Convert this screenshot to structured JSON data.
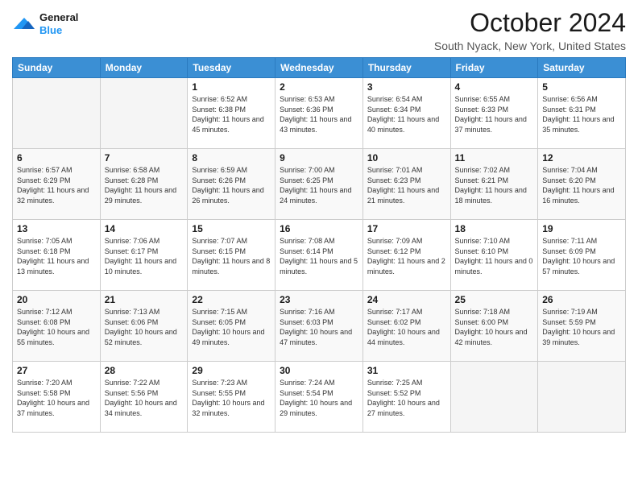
{
  "header": {
    "logo_line1": "General",
    "logo_line2": "Blue",
    "month_title": "October 2024",
    "location": "South Nyack, New York, United States"
  },
  "weekdays": [
    "Sunday",
    "Monday",
    "Tuesday",
    "Wednesday",
    "Thursday",
    "Friday",
    "Saturday"
  ],
  "weeks": [
    [
      {
        "day": null
      },
      {
        "day": null
      },
      {
        "day": "1",
        "sunrise": "Sunrise: 6:52 AM",
        "sunset": "Sunset: 6:38 PM",
        "daylight": "Daylight: 11 hours and 45 minutes."
      },
      {
        "day": "2",
        "sunrise": "Sunrise: 6:53 AM",
        "sunset": "Sunset: 6:36 PM",
        "daylight": "Daylight: 11 hours and 43 minutes."
      },
      {
        "day": "3",
        "sunrise": "Sunrise: 6:54 AM",
        "sunset": "Sunset: 6:34 PM",
        "daylight": "Daylight: 11 hours and 40 minutes."
      },
      {
        "day": "4",
        "sunrise": "Sunrise: 6:55 AM",
        "sunset": "Sunset: 6:33 PM",
        "daylight": "Daylight: 11 hours and 37 minutes."
      },
      {
        "day": "5",
        "sunrise": "Sunrise: 6:56 AM",
        "sunset": "Sunset: 6:31 PM",
        "daylight": "Daylight: 11 hours and 35 minutes."
      }
    ],
    [
      {
        "day": "6",
        "sunrise": "Sunrise: 6:57 AM",
        "sunset": "Sunset: 6:29 PM",
        "daylight": "Daylight: 11 hours and 32 minutes."
      },
      {
        "day": "7",
        "sunrise": "Sunrise: 6:58 AM",
        "sunset": "Sunset: 6:28 PM",
        "daylight": "Daylight: 11 hours and 29 minutes."
      },
      {
        "day": "8",
        "sunrise": "Sunrise: 6:59 AM",
        "sunset": "Sunset: 6:26 PM",
        "daylight": "Daylight: 11 hours and 26 minutes."
      },
      {
        "day": "9",
        "sunrise": "Sunrise: 7:00 AM",
        "sunset": "Sunset: 6:25 PM",
        "daylight": "Daylight: 11 hours and 24 minutes."
      },
      {
        "day": "10",
        "sunrise": "Sunrise: 7:01 AM",
        "sunset": "Sunset: 6:23 PM",
        "daylight": "Daylight: 11 hours and 21 minutes."
      },
      {
        "day": "11",
        "sunrise": "Sunrise: 7:02 AM",
        "sunset": "Sunset: 6:21 PM",
        "daylight": "Daylight: 11 hours and 18 minutes."
      },
      {
        "day": "12",
        "sunrise": "Sunrise: 7:04 AM",
        "sunset": "Sunset: 6:20 PM",
        "daylight": "Daylight: 11 hours and 16 minutes."
      }
    ],
    [
      {
        "day": "13",
        "sunrise": "Sunrise: 7:05 AM",
        "sunset": "Sunset: 6:18 PM",
        "daylight": "Daylight: 11 hours and 13 minutes."
      },
      {
        "day": "14",
        "sunrise": "Sunrise: 7:06 AM",
        "sunset": "Sunset: 6:17 PM",
        "daylight": "Daylight: 11 hours and 10 minutes."
      },
      {
        "day": "15",
        "sunrise": "Sunrise: 7:07 AM",
        "sunset": "Sunset: 6:15 PM",
        "daylight": "Daylight: 11 hours and 8 minutes."
      },
      {
        "day": "16",
        "sunrise": "Sunrise: 7:08 AM",
        "sunset": "Sunset: 6:14 PM",
        "daylight": "Daylight: 11 hours and 5 minutes."
      },
      {
        "day": "17",
        "sunrise": "Sunrise: 7:09 AM",
        "sunset": "Sunset: 6:12 PM",
        "daylight": "Daylight: 11 hours and 2 minutes."
      },
      {
        "day": "18",
        "sunrise": "Sunrise: 7:10 AM",
        "sunset": "Sunset: 6:10 PM",
        "daylight": "Daylight: 11 hours and 0 minutes."
      },
      {
        "day": "19",
        "sunrise": "Sunrise: 7:11 AM",
        "sunset": "Sunset: 6:09 PM",
        "daylight": "Daylight: 10 hours and 57 minutes."
      }
    ],
    [
      {
        "day": "20",
        "sunrise": "Sunrise: 7:12 AM",
        "sunset": "Sunset: 6:08 PM",
        "daylight": "Daylight: 10 hours and 55 minutes."
      },
      {
        "day": "21",
        "sunrise": "Sunrise: 7:13 AM",
        "sunset": "Sunset: 6:06 PM",
        "daylight": "Daylight: 10 hours and 52 minutes."
      },
      {
        "day": "22",
        "sunrise": "Sunrise: 7:15 AM",
        "sunset": "Sunset: 6:05 PM",
        "daylight": "Daylight: 10 hours and 49 minutes."
      },
      {
        "day": "23",
        "sunrise": "Sunrise: 7:16 AM",
        "sunset": "Sunset: 6:03 PM",
        "daylight": "Daylight: 10 hours and 47 minutes."
      },
      {
        "day": "24",
        "sunrise": "Sunrise: 7:17 AM",
        "sunset": "Sunset: 6:02 PM",
        "daylight": "Daylight: 10 hours and 44 minutes."
      },
      {
        "day": "25",
        "sunrise": "Sunrise: 7:18 AM",
        "sunset": "Sunset: 6:00 PM",
        "daylight": "Daylight: 10 hours and 42 minutes."
      },
      {
        "day": "26",
        "sunrise": "Sunrise: 7:19 AM",
        "sunset": "Sunset: 5:59 PM",
        "daylight": "Daylight: 10 hours and 39 minutes."
      }
    ],
    [
      {
        "day": "27",
        "sunrise": "Sunrise: 7:20 AM",
        "sunset": "Sunset: 5:58 PM",
        "daylight": "Daylight: 10 hours and 37 minutes."
      },
      {
        "day": "28",
        "sunrise": "Sunrise: 7:22 AM",
        "sunset": "Sunset: 5:56 PM",
        "daylight": "Daylight: 10 hours and 34 minutes."
      },
      {
        "day": "29",
        "sunrise": "Sunrise: 7:23 AM",
        "sunset": "Sunset: 5:55 PM",
        "daylight": "Daylight: 10 hours and 32 minutes."
      },
      {
        "day": "30",
        "sunrise": "Sunrise: 7:24 AM",
        "sunset": "Sunset: 5:54 PM",
        "daylight": "Daylight: 10 hours and 29 minutes."
      },
      {
        "day": "31",
        "sunrise": "Sunrise: 7:25 AM",
        "sunset": "Sunset: 5:52 PM",
        "daylight": "Daylight: 10 hours and 27 minutes."
      },
      {
        "day": null
      },
      {
        "day": null
      }
    ]
  ]
}
